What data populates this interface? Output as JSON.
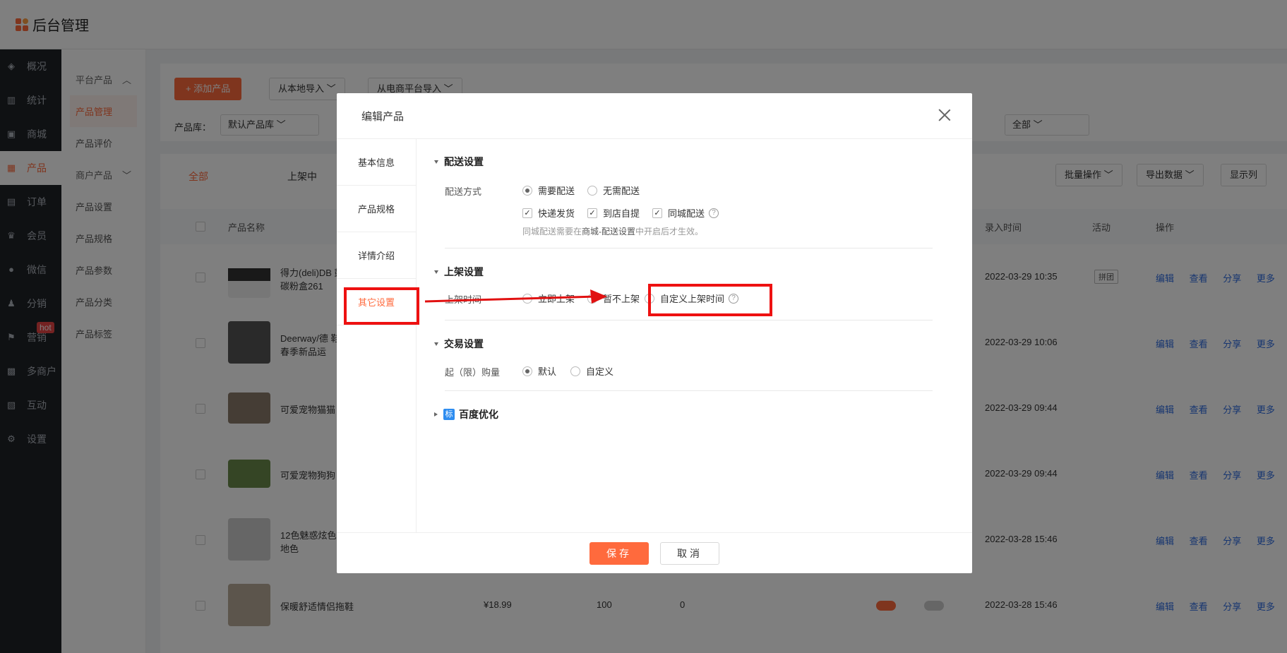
{
  "app": {
    "title": "后台管理"
  },
  "sidebar": {
    "items": [
      {
        "label": "概况",
        "icon": "layers-icon"
      },
      {
        "label": "统计",
        "icon": "chart-icon"
      },
      {
        "label": "商城",
        "icon": "shop-icon"
      },
      {
        "label": "产品",
        "icon": "grid-icon",
        "active": true
      },
      {
        "label": "订单",
        "icon": "order-icon"
      },
      {
        "label": "会员",
        "icon": "crown-icon"
      },
      {
        "label": "微信",
        "icon": "wechat-icon"
      },
      {
        "label": "分销",
        "icon": "user-share-icon"
      },
      {
        "label": "营销",
        "icon": "flag-icon",
        "badge": "hot"
      },
      {
        "label": "多商户",
        "icon": "store-icon"
      },
      {
        "label": "互动",
        "icon": "interact-icon"
      },
      {
        "label": "设置",
        "icon": "gear-icon"
      }
    ]
  },
  "subnav": {
    "group1": "平台产品",
    "item_manage": "产品管理",
    "item_review": "产品评价",
    "group2": "商户产品",
    "item_settings": "产品设置",
    "item_specs": "产品规格",
    "item_params": "产品参数",
    "item_category": "产品分类",
    "item_tags": "产品标签"
  },
  "main": {
    "add_button": "+ 添加产品",
    "import_local": "从本地导入",
    "import_platform": "从电商平台导入",
    "library_label": "产品库：",
    "library_value": "默认产品库",
    "filter_all": "全部",
    "tabs": [
      "全部",
      "上架中"
    ],
    "batch_op": "批量操作",
    "export": "导出数据",
    "show_cols": "显示列",
    "headers": {
      "name": "产品名称",
      "time": "录入时间",
      "activity": "活动",
      "ops": "操作"
    },
    "rows": [
      {
        "name": "得力(deli)DB 鼓 碳粉盒261",
        "time": "2022-03-29 10:35",
        "tag": "拼团"
      },
      {
        "name": "Deerway/德 鞋春季新品运",
        "time": "2022-03-29 10:06"
      },
      {
        "name": "可爱宠物猫猫",
        "time": "2022-03-29 09:44"
      },
      {
        "name": "可爱宠物狗狗",
        "time": "2022-03-29 09:44"
      },
      {
        "name": "12色魅惑炫色 地色",
        "time": "2022-03-28 15:46"
      },
      {
        "name": "保暖舒适情侣拖鞋",
        "price": "¥18.99",
        "stock": "100",
        "sales": "0",
        "time": "2022-03-28 15:46"
      }
    ],
    "actions": [
      "编辑",
      "查看",
      "分享",
      "更多"
    ]
  },
  "modal": {
    "title": "编辑产品",
    "nav": [
      "基本信息",
      "产品规格",
      "详情介绍",
      "其它设置"
    ],
    "delivery": {
      "title": "配送设置",
      "method_label": "配送方式",
      "need": "需要配送",
      "no_need": "无需配送",
      "express": "快递发货",
      "pickup": "到店自提",
      "local": "同城配送",
      "hint_pre": "同城配送需要在",
      "hint_link": "商城-配送设置",
      "hint_post": "中开启后才生效。"
    },
    "shelf": {
      "title": "上架设置",
      "time_label": "上架时间",
      "opt_all": "立即上架",
      "opt_not": "暂不上架",
      "opt_custom": "自定义上架时间"
    },
    "trade": {
      "title": "交易设置",
      "qty_label": "起（限）购量",
      "default": "默认",
      "custom": "自定义"
    },
    "baidu": {
      "badge": "标",
      "title": "百度优化"
    },
    "save": "保存",
    "cancel": "取消"
  },
  "colors": {
    "accent": "#ff6a3d",
    "sidebar": "#1f2227",
    "annotation": "#e11111",
    "link": "#2d6ae0"
  }
}
